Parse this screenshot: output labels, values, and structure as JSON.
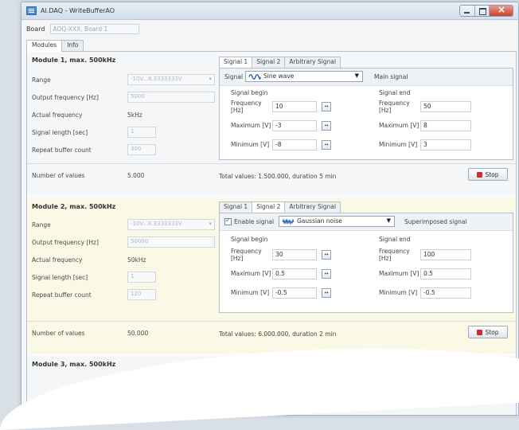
{
  "window": {
    "title": "AI.DAQ - WriteBufferAO"
  },
  "board": {
    "label": "Board",
    "value": "ADQ-XXX, Board 1"
  },
  "tabs": [
    "Modules",
    "Info"
  ],
  "signal_tabs": [
    "Signal 1",
    "Signal 2",
    "Arbitrary Signal"
  ],
  "module1": {
    "title": "Module 1, max. 500kHz",
    "range_label": "Range",
    "range_value": "-10V...8.3333333V",
    "output_freq_label": "Output frequency [Hz]",
    "output_freq_value": "5000",
    "actual_freq_label": "Actual frequency",
    "actual_freq_value": "5kHz",
    "signal_length_label": "Signal length [sec]",
    "signal_length_value": "1",
    "repeat_label": "Repeat buffer count",
    "repeat_value": "300",
    "num_values_label": "Number of values",
    "num_values": "5.000",
    "signal_label": "Signal",
    "signal_type": "Sine wave",
    "signal_mode": "Main signal",
    "begin_title": "Signal begin",
    "end_title": "Signal end",
    "freq_label": "Frequency [Hz]",
    "max_label": "Maximum [V]",
    "min_label": "Minimum [V]",
    "begin": {
      "freq": "10",
      "max": "-3",
      "min": "-8"
    },
    "end": {
      "freq": "50",
      "max": "8",
      "min": "3"
    },
    "total": "Total values: 1.500.000, duration 5 min",
    "stop_label": "Stop"
  },
  "module2": {
    "title": "Module 2, max. 500kHz",
    "range_label": "Range",
    "range_value": "-10V...8.3333333V",
    "output_freq_label": "Output frequency [Hz]",
    "output_freq_value": "50000",
    "actual_freq_label": "Actual frequency",
    "actual_freq_value": "50kHz",
    "signal_length_label": "Signal length [sec]",
    "signal_length_value": "1",
    "repeat_label": "Repeat buffer count",
    "repeat_value": "120",
    "num_values_label": "Number of values",
    "num_values": "50.000",
    "enable_label": "Enable signal",
    "signal_type": "Gaussian noise",
    "signal_mode": "Superimposed signal",
    "begin_title": "Signal begin",
    "end_title": "Signal end",
    "freq_label": "Frequency [Hz]",
    "max_label": "Maximum [V]",
    "min_label": "Minimum [V]",
    "begin": {
      "freq": "30",
      "max": "0.5",
      "min": "-0.5"
    },
    "end": {
      "freq": "100",
      "max": "0.5",
      "min": "-0.5"
    },
    "total": "Total values: 6.000.000, duration 2 min",
    "stop_label": "Stop"
  },
  "module3": {
    "title": "Module 3, max. 500kHz"
  },
  "icons": {
    "app": "app-icon",
    "sine": "sine-wave-icon",
    "noise": "noise-wave-icon",
    "stop": "stop-icon"
  },
  "colors": {
    "module2_bg": "#fbf8e5",
    "stop_red": "#d62b2b",
    "accent": "#2a5fb0"
  }
}
